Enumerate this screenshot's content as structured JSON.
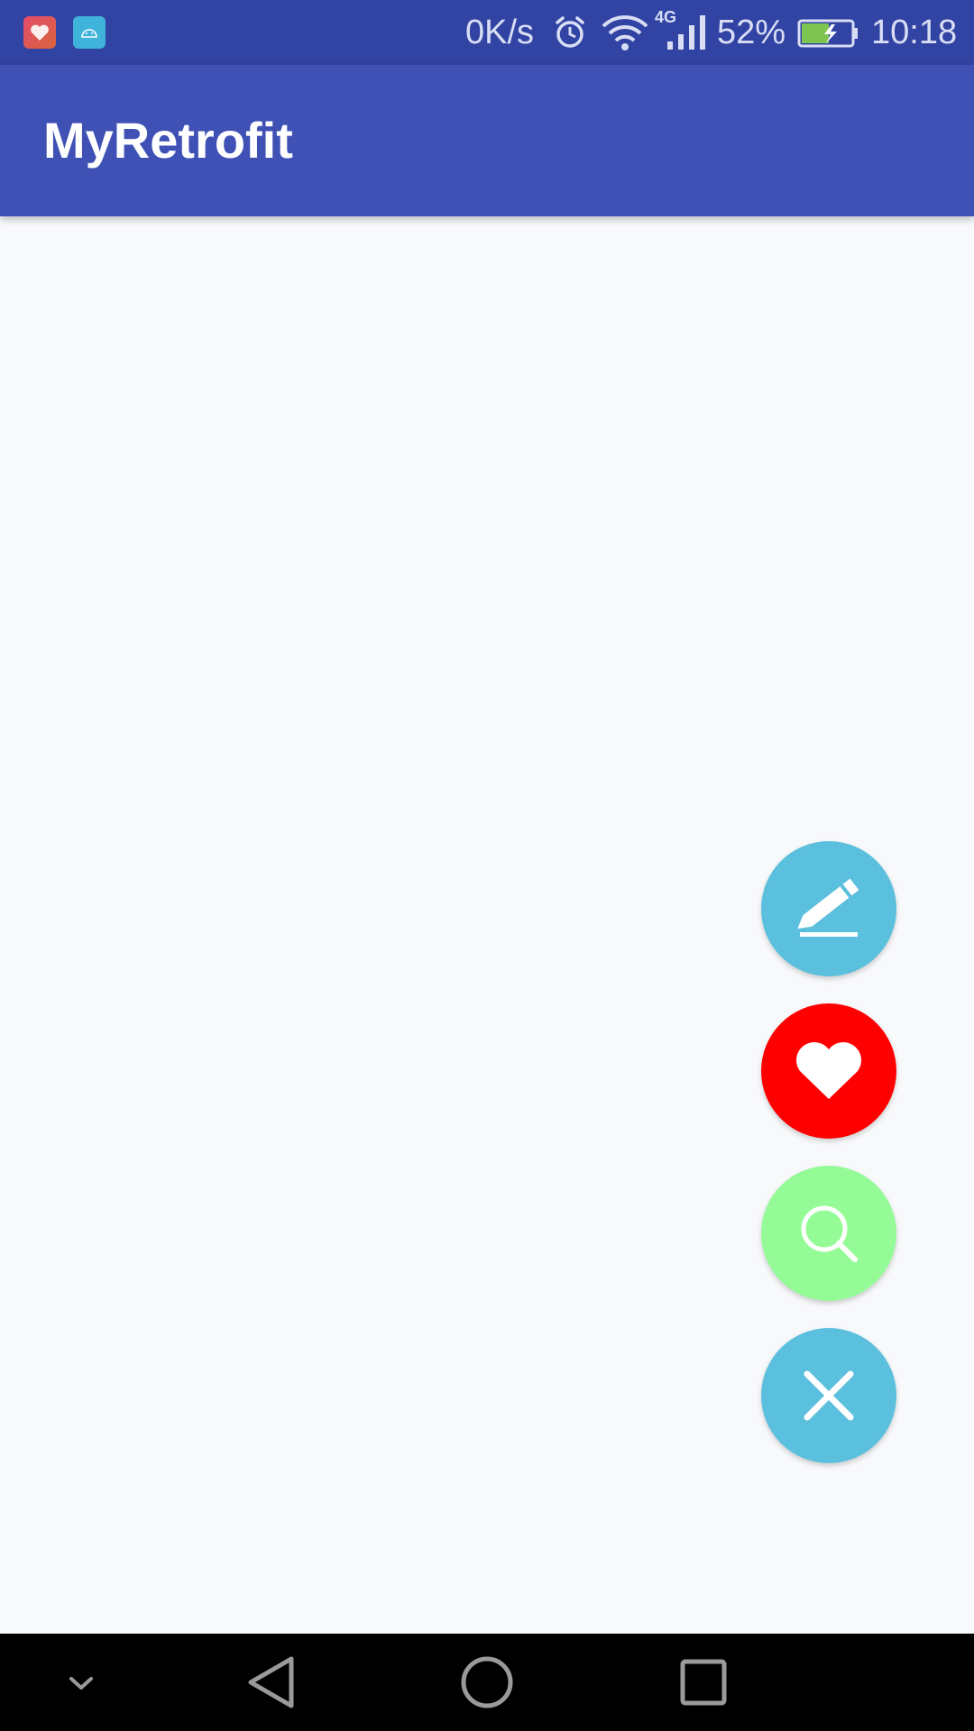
{
  "status_bar": {
    "net_speed": "0K/s",
    "network_type": "4G",
    "battery_percent": "52%",
    "time": "10:18",
    "notification_icons": [
      "health-app-icon",
      "android-icon"
    ],
    "system_icons": [
      "alarm-icon",
      "wifi-icon",
      "signal-icon",
      "battery-charging-icon"
    ]
  },
  "app_bar": {
    "title": "MyRetrofit"
  },
  "fabs": [
    {
      "icon": "edit-icon",
      "color": "#5bbfde"
    },
    {
      "icon": "heart-icon",
      "color": "#ff0000"
    },
    {
      "icon": "search-icon",
      "color": "#95fb97"
    },
    {
      "icon": "close-icon",
      "color": "#5bbfde"
    }
  ],
  "nav_bar": {
    "icons": [
      "chevron-down-icon",
      "back-icon",
      "home-icon",
      "recents-icon"
    ]
  },
  "colors": {
    "status_bar": "#3143a3",
    "app_bar": "#3f51b5",
    "background": "#f8f9fb"
  }
}
